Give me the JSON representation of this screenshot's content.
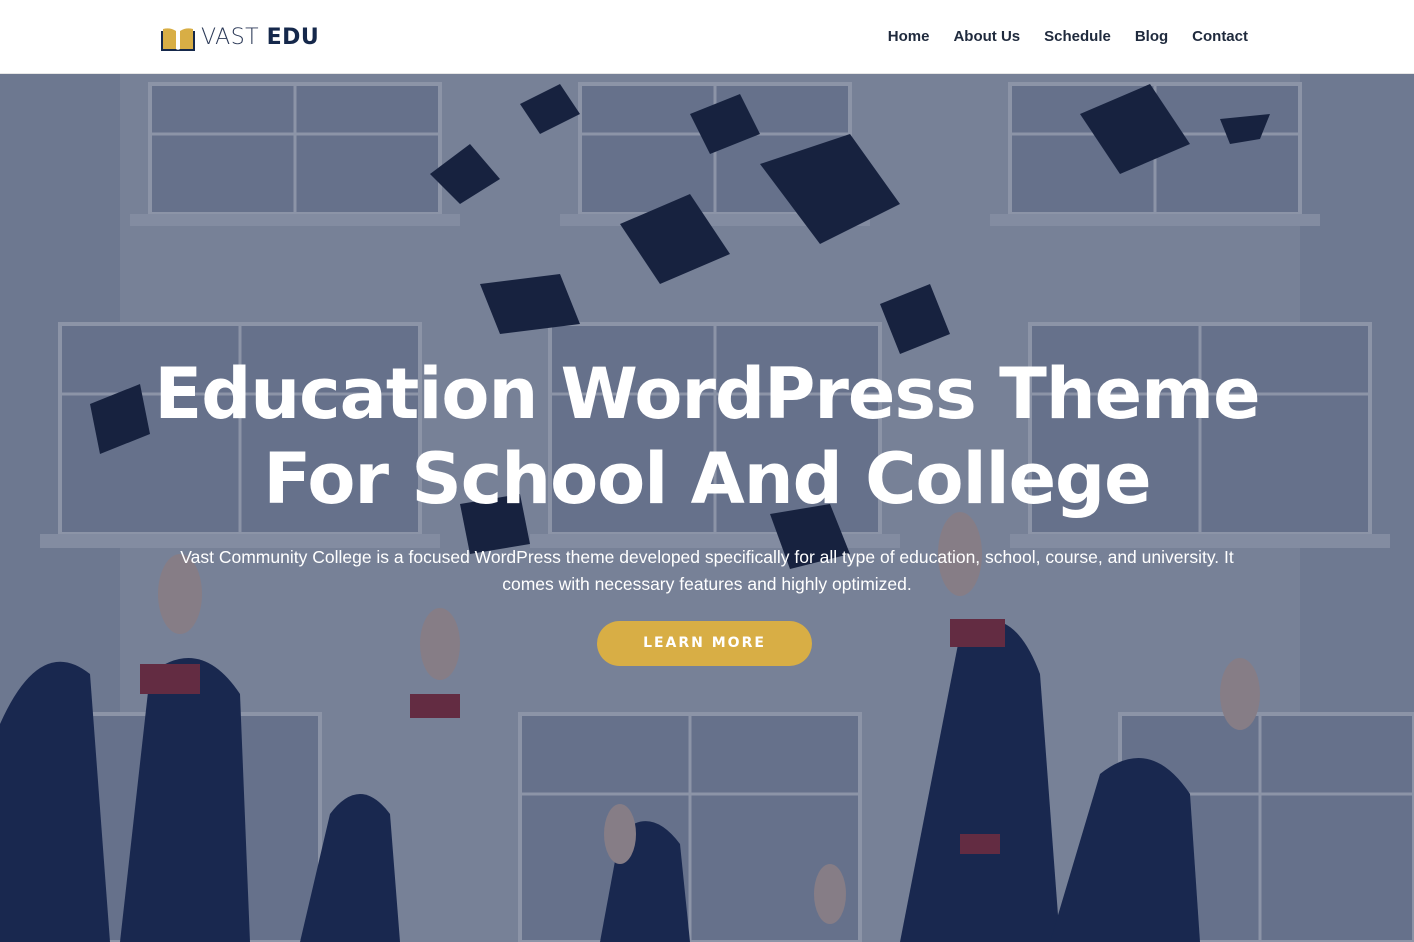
{
  "header": {
    "logo": {
      "text_light": "VAST ",
      "text_bold": "EDU",
      "icon": "open-book-icon"
    },
    "nav": [
      {
        "label": "Home"
      },
      {
        "label": "About Us"
      },
      {
        "label": "Schedule"
      },
      {
        "label": "Blog"
      },
      {
        "label": "Contact"
      }
    ]
  },
  "hero": {
    "title_line1": "Education WordPress Theme",
    "title_line2": "For School And College",
    "description": "Vast Community College is a focused WordPress theme developed specifically for all type of education, school, course, and university. It comes with necessary features and highly optimized.",
    "button_label": "LEARN MORE",
    "background": "graduates-throwing-caps-photo"
  },
  "colors": {
    "accent": "#d8ae45",
    "brand_dark": "#15284b",
    "overlay": "#14244a",
    "nav_text": "#1f2a3d"
  }
}
